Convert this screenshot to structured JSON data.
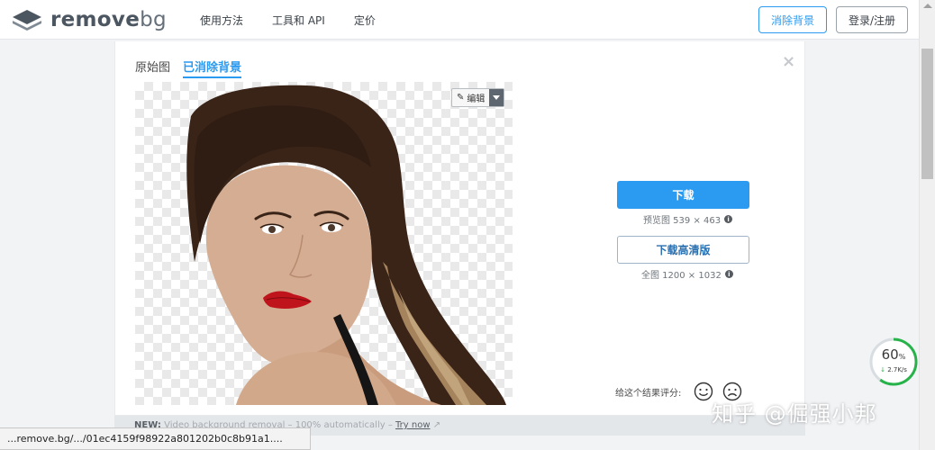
{
  "header": {
    "logo_text_main": "remove",
    "logo_text_bg": "bg",
    "nav": [
      "使用方法",
      "工具和 API",
      "定价"
    ],
    "btn_remove": "消除背景",
    "btn_login": "登录/注册"
  },
  "card": {
    "tabs": [
      "原始图",
      "已消除背景"
    ],
    "active_tab": "已消除背景",
    "close": "×",
    "edit_label": "编辑",
    "download_label": "下载",
    "preview_info": "预览图 539 × 463",
    "download_hd_label": "下载高清版",
    "full_info": "全图 1200 × 1032",
    "rate_label": "给这个结果评分:"
  },
  "notice": {
    "new": "NEW:",
    "text": " Video background removal – 100% automatically – ",
    "try": "Try now"
  },
  "statusbar": {
    "url": "...remove.bg/.../01ec4159f98922a801202b0c8b91a1...."
  },
  "speed_widget": {
    "percent": "60",
    "percent_unit": "%",
    "rate": "2.7K/s",
    "progress": 0.6
  },
  "watermark": "知乎 @倔强小邦",
  "colors": {
    "accent": "#2a9bf0",
    "speed_ring": "#27b34a"
  }
}
